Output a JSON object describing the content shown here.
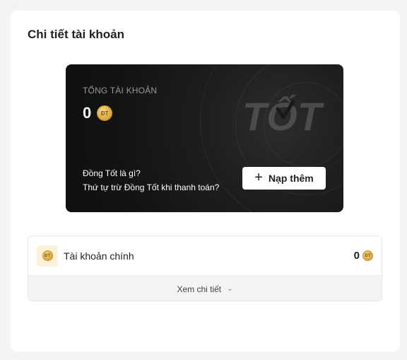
{
  "page": {
    "title": "Chi tiết tài khoản"
  },
  "card": {
    "heading": "TỔNG TÀI KHOẢN",
    "balance": "0",
    "coin_label": "ĐT",
    "brand_text": "TỐT",
    "link_what": "Đồng Tốt là gì?",
    "link_order": "Thứ tự trừ Đồng Tốt khi thanh toán?",
    "topup_label": "Nạp thêm",
    "topup_icon": "plus-icon"
  },
  "accounts": [
    {
      "label": "Tài khoản chính",
      "value": "0",
      "icon": "coin-icon"
    }
  ],
  "details": {
    "label": "Xem chi tiết",
    "icon": "chevron-down-icon"
  },
  "colors": {
    "card_bg": "#141313",
    "coin_gold": "#d7a33b",
    "account_icon_bg": "#fdf2d9",
    "details_bg": "#f4f4f4"
  }
}
